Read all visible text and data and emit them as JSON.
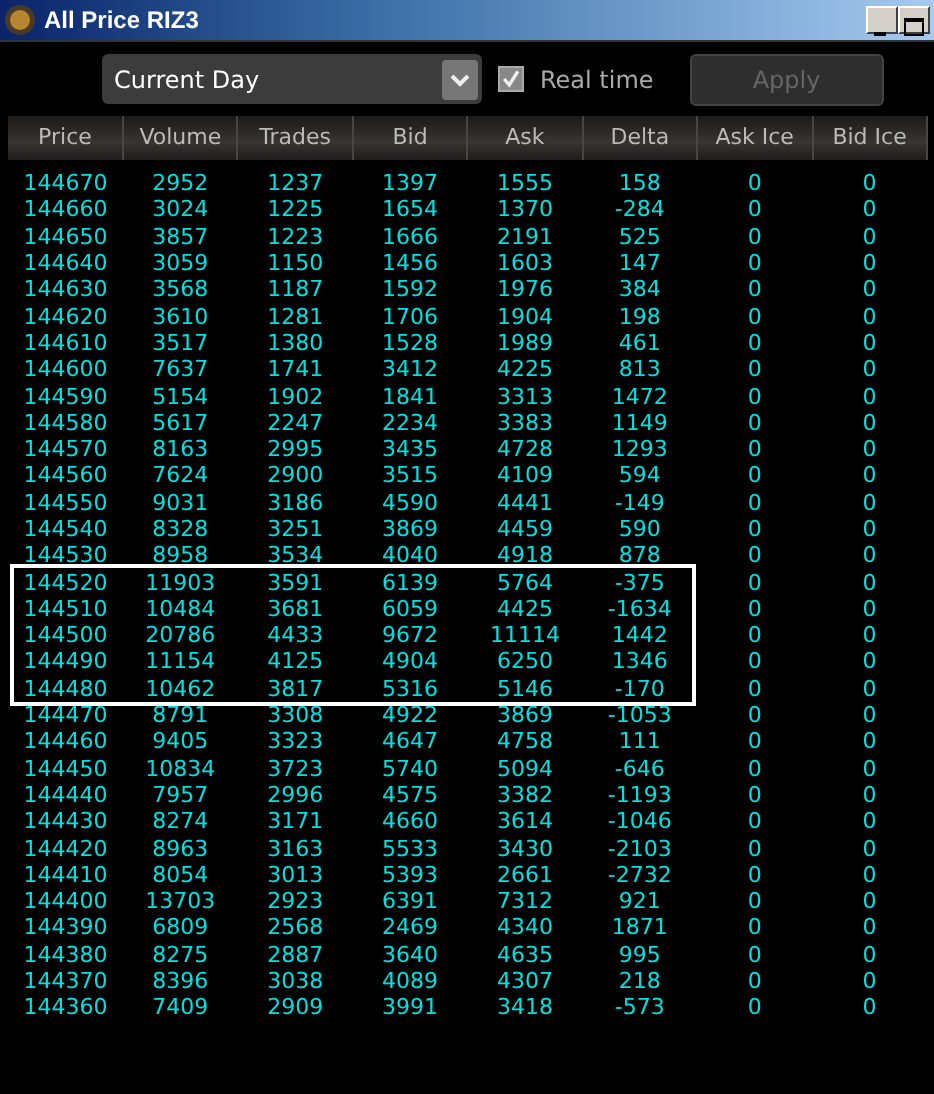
{
  "window": {
    "title": "All Price RIZ3"
  },
  "toolbar": {
    "period": "Current Day",
    "realtime": {
      "label": "Real time",
      "checked": true
    },
    "apply": {
      "label": "Apply",
      "disabled": true
    }
  },
  "table": {
    "columns": [
      "Price",
      "Volume",
      "Trades",
      "Bid",
      "Ask",
      "Delta",
      "Ask Ice",
      "Bid Ice"
    ],
    "rows": [
      {
        "cells": [
          "144670",
          "2952",
          "1237",
          "1397",
          "1555",
          "158",
          "0",
          "0"
        ],
        "highlighted": false
      },
      {
        "cells": [
          "144660",
          "3024",
          "1225",
          "1654",
          "1370",
          "-284",
          "0",
          "0"
        ],
        "highlighted": false
      },
      {
        "cells": [
          "144650",
          "3857",
          "1223",
          "1666",
          "2191",
          "525",
          "0",
          "0"
        ],
        "highlighted": false
      },
      {
        "cells": [
          "144640",
          "3059",
          "1150",
          "1456",
          "1603",
          "147",
          "0",
          "0"
        ],
        "highlighted": false
      },
      {
        "cells": [
          "144630",
          "3568",
          "1187",
          "1592",
          "1976",
          "384",
          "0",
          "0"
        ],
        "highlighted": false
      },
      {
        "cells": [
          "144620",
          "3610",
          "1281",
          "1706",
          "1904",
          "198",
          "0",
          "0"
        ],
        "highlighted": false
      },
      {
        "cells": [
          "144610",
          "3517",
          "1380",
          "1528",
          "1989",
          "461",
          "0",
          "0"
        ],
        "highlighted": false
      },
      {
        "cells": [
          "144600",
          "7637",
          "1741",
          "3412",
          "4225",
          "813",
          "0",
          "0"
        ],
        "highlighted": false
      },
      {
        "cells": [
          "144590",
          "5154",
          "1902",
          "1841",
          "3313",
          "1472",
          "0",
          "0"
        ],
        "highlighted": false
      },
      {
        "cells": [
          "144580",
          "5617",
          "2247",
          "2234",
          "3383",
          "1149",
          "0",
          "0"
        ],
        "highlighted": false
      },
      {
        "cells": [
          "144570",
          "8163",
          "2995",
          "3435",
          "4728",
          "1293",
          "0",
          "0"
        ],
        "highlighted": false
      },
      {
        "cells": [
          "144560",
          "7624",
          "2900",
          "3515",
          "4109",
          "594",
          "0",
          "0"
        ],
        "highlighted": false
      },
      {
        "cells": [
          "144550",
          "9031",
          "3186",
          "4590",
          "4441",
          "-149",
          "0",
          "0"
        ],
        "highlighted": false
      },
      {
        "cells": [
          "144540",
          "8328",
          "3251",
          "3869",
          "4459",
          "590",
          "0",
          "0"
        ],
        "highlighted": false
      },
      {
        "cells": [
          "144530",
          "8958",
          "3534",
          "4040",
          "4918",
          "878",
          "0",
          "0"
        ],
        "highlighted": false
      },
      {
        "cells": [
          "144520",
          "11903",
          "3591",
          "6139",
          "5764",
          "-375",
          "0",
          "0"
        ],
        "highlighted": true
      },
      {
        "cells": [
          "144510",
          "10484",
          "3681",
          "6059",
          "4425",
          "-1634",
          "0",
          "0"
        ],
        "highlighted": true
      },
      {
        "cells": [
          "144500",
          "20786",
          "4433",
          "9672",
          "11114",
          "1442",
          "0",
          "0"
        ],
        "highlighted": true
      },
      {
        "cells": [
          "144490",
          "11154",
          "4125",
          "4904",
          "6250",
          "1346",
          "0",
          "0"
        ],
        "highlighted": true
      },
      {
        "cells": [
          "144480",
          "10462",
          "3817",
          "5316",
          "5146",
          "-170",
          "0",
          "0"
        ],
        "highlighted": true
      },
      {
        "cells": [
          "144470",
          "8791",
          "3308",
          "4922",
          "3869",
          "-1053",
          "0",
          "0"
        ],
        "highlighted": false
      },
      {
        "cells": [
          "144460",
          "9405",
          "3323",
          "4647",
          "4758",
          "111",
          "0",
          "0"
        ],
        "highlighted": false
      },
      {
        "cells": [
          "144450",
          "10834",
          "3723",
          "5740",
          "5094",
          "-646",
          "0",
          "0"
        ],
        "highlighted": false
      },
      {
        "cells": [
          "144440",
          "7957",
          "2996",
          "4575",
          "3382",
          "-1193",
          "0",
          "0"
        ],
        "highlighted": false
      },
      {
        "cells": [
          "144430",
          "8274",
          "3171",
          "4660",
          "3614",
          "-1046",
          "0",
          "0"
        ],
        "highlighted": false
      },
      {
        "cells": [
          "144420",
          "8963",
          "3163",
          "5533",
          "3430",
          "-2103",
          "0",
          "0"
        ],
        "highlighted": false
      },
      {
        "cells": [
          "144410",
          "8054",
          "3013",
          "5393",
          "2661",
          "-2732",
          "0",
          "0"
        ],
        "highlighted": false
      },
      {
        "cells": [
          "144400",
          "13703",
          "2923",
          "6391",
          "7312",
          "921",
          "0",
          "0"
        ],
        "highlighted": false
      },
      {
        "cells": [
          "144390",
          "6809",
          "2568",
          "2469",
          "4340",
          "1871",
          "0",
          "0"
        ],
        "highlighted": false
      },
      {
        "cells": [
          "144380",
          "8275",
          "2887",
          "3640",
          "4635",
          "995",
          "0",
          "0"
        ],
        "highlighted": false
      },
      {
        "cells": [
          "144370",
          "8396",
          "3038",
          "4089",
          "4307",
          "218",
          "0",
          "0"
        ],
        "highlighted": false
      },
      {
        "cells": [
          "144360",
          "7409",
          "2909",
          "3991",
          "3418",
          "-573",
          "0",
          "0"
        ],
        "highlighted": false
      }
    ]
  }
}
